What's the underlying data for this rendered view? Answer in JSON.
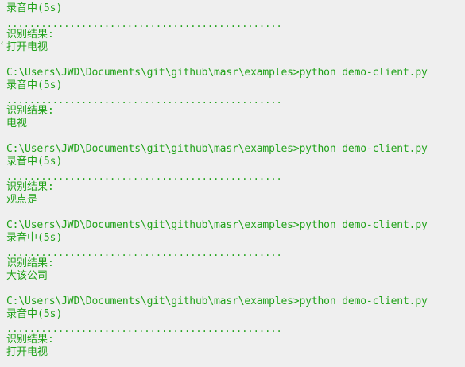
{
  "console": {
    "lines": [
      {
        "type": "status",
        "text": "录音中(5s)"
      },
      {
        "type": "dots",
        "text": "................................................"
      },
      {
        "type": "label",
        "text": "识别结果:"
      },
      {
        "type": "result",
        "text": "打开电视"
      },
      {
        "type": "command",
        "text": "C:\\Users\\JWD\\Documents\\git\\github\\masr\\examples>python demo-client.py"
      },
      {
        "type": "status",
        "text": "录音中(5s)"
      },
      {
        "type": "dots",
        "text": "................................................"
      },
      {
        "type": "label",
        "text": "识别结果:"
      },
      {
        "type": "result",
        "text": "电视"
      },
      {
        "type": "command",
        "text": "C:\\Users\\JWD\\Documents\\git\\github\\masr\\examples>python demo-client.py"
      },
      {
        "type": "status",
        "text": "录音中(5s)"
      },
      {
        "type": "dots",
        "text": "................................................"
      },
      {
        "type": "label",
        "text": "识别结果:"
      },
      {
        "type": "result",
        "text": "观点是"
      },
      {
        "type": "command",
        "text": "C:\\Users\\JWD\\Documents\\git\\github\\masr\\examples>python demo-client.py"
      },
      {
        "type": "status",
        "text": "录音中(5s)"
      },
      {
        "type": "dots",
        "text": "................................................"
      },
      {
        "type": "label",
        "text": "识别结果:"
      },
      {
        "type": "result",
        "text": "大该公司"
      },
      {
        "type": "command",
        "text": "C:\\Users\\JWD\\Documents\\git\\github\\masr\\examples>python demo-client.py"
      },
      {
        "type": "status",
        "text": "录音中(5s)"
      },
      {
        "type": "dots",
        "text": "................................................"
      },
      {
        "type": "label",
        "text": "识别结果:"
      },
      {
        "type": "result",
        "text": "打开电视"
      }
    ]
  },
  "colors": {
    "background": "#efefef",
    "text": "#21a21a"
  }
}
